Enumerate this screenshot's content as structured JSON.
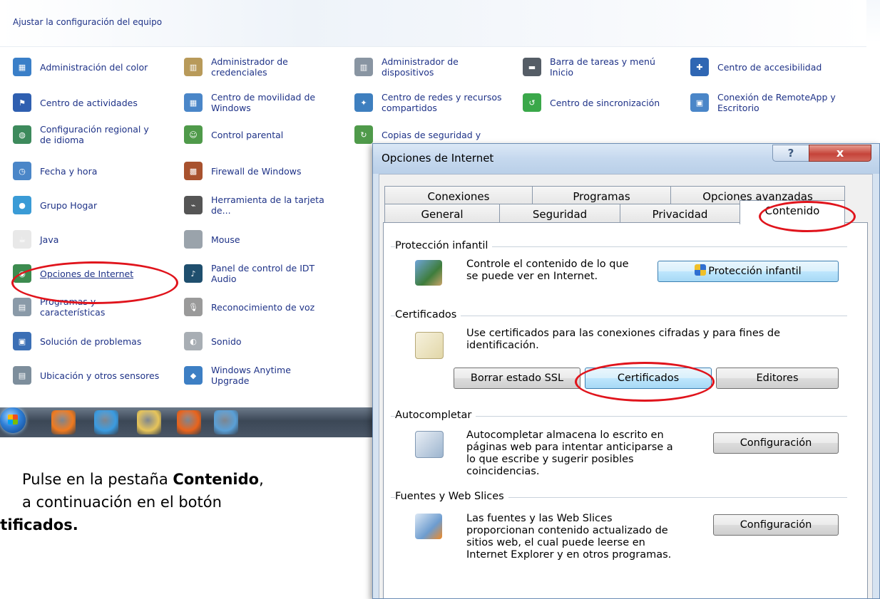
{
  "control_panel": {
    "title": "Ajustar la configuración del equipo",
    "columns": [
      [
        {
          "label": "Administración del color",
          "icon": "color-management-icon",
          "color": "#3a7fc8"
        },
        {
          "label": "Centro de actividades",
          "icon": "action-center-flag-icon",
          "color": "#2f5fb0"
        },
        {
          "label": "Configuración regional y\nde idioma",
          "icon": "region-globe-icon",
          "color": "#3d8a5c"
        },
        {
          "label": "Fecha y hora",
          "icon": "date-time-icon",
          "color": "#4a86c8"
        },
        {
          "label": "Grupo Hogar",
          "icon": "homegroup-icon",
          "color": "#3a9bd6"
        },
        {
          "label": "Java",
          "icon": "java-icon",
          "color": "#e8e8e8"
        },
        {
          "label": "Opciones de Internet",
          "icon": "internet-options-icon",
          "color": "#3c8b4f"
        },
        {
          "label": "Programas y\ncaracterísticas",
          "icon": "programs-features-icon",
          "color": "#8a9aa8"
        },
        {
          "label": "Solución de problemas",
          "icon": "troubleshooting-icon",
          "color": "#3b6fb5"
        },
        {
          "label": "Ubicación y otros sensores",
          "icon": "location-sensors-icon",
          "color": "#7d8e9c"
        }
      ],
      [
        {
          "label": "Administrador de\ncredenciales",
          "icon": "credential-manager-icon",
          "color": "#b89a5a"
        },
        {
          "label": "Centro de movilidad de\nWindows",
          "icon": "mobility-center-icon",
          "color": "#4a86c8"
        },
        {
          "label": "Control parental",
          "icon": "parental-control-icon",
          "color": "#4f9a4a"
        },
        {
          "label": "Firewall de Windows",
          "icon": "firewall-icon",
          "color": "#a8522e"
        },
        {
          "label": "Herramienta de la tarjeta\nde...",
          "icon": "card-tool-icon",
          "color": "#555555"
        },
        {
          "label": "Mouse",
          "icon": "mouse-icon",
          "color": "#9aa3ab"
        },
        {
          "label": "Panel de control de IDT\nAudio",
          "icon": "idt-audio-icon",
          "color": "#1f4f6e"
        },
        {
          "label": "Reconocimiento de voz",
          "icon": "microphone-icon",
          "color": "#9a9a9a"
        },
        {
          "label": "Sonido",
          "icon": "speaker-icon",
          "color": "#a8aeb4"
        },
        {
          "label": "Windows Anytime\nUpgrade",
          "icon": "anytime-upgrade-icon",
          "color": "#3d7fc4"
        }
      ],
      [
        {
          "label": "Administrador de\ndispositivos",
          "icon": "device-manager-icon",
          "color": "#8995a2"
        },
        {
          "label": "Centro de redes y recursos\ncompartidos",
          "icon": "network-center-icon",
          "color": "#3e7fbf"
        },
        {
          "label": "Copias de seguridad y",
          "icon": "backup-icon",
          "color": "#4f9a4a"
        }
      ],
      [
        {
          "label": "Barra de tareas y menú\nInicio",
          "icon": "taskbar-start-icon",
          "color": "#555d66"
        },
        {
          "label": "Centro de sincronización",
          "icon": "sync-center-icon",
          "color": "#3aa84a"
        }
      ],
      [
        {
          "label": "Centro de accesibilidad",
          "icon": "accessibility-icon",
          "color": "#2f66b3"
        },
        {
          "label": "Conexión de RemoteApp y\nEscritorio",
          "icon": "remoteapp-icon",
          "color": "#4a86c8"
        }
      ]
    ]
  },
  "taskbar": {
    "buttons": [
      {
        "icon": "windows-start-orb-icon"
      },
      {
        "icon": "media-player-icon",
        "color": "#f07a1f"
      },
      {
        "icon": "internet-explorer-icon",
        "color": "#3b9be0"
      },
      {
        "icon": "file-explorer-folder-icon",
        "color": "#e6c45a"
      },
      {
        "icon": "firefox-icon",
        "color": "#e8631c"
      },
      {
        "icon": "control-panel-icon",
        "color": "#5a9fd6"
      }
    ]
  },
  "instruction": {
    "line1_pre": "Pulse en la pestaña ",
    "line1_bold": "Contenido",
    "line1_post": ",",
    "line2": "a continuación en el botón",
    "line3_bold": "rtificados."
  },
  "dialog": {
    "title": "Opciones de Internet",
    "help_label": "?",
    "close_label": "x",
    "tabs_row1": [
      "Conexiones",
      "Programas",
      "Opciones avanzadas"
    ],
    "tabs_row2": [
      "General",
      "Seguridad",
      "Privacidad",
      "Contenido"
    ],
    "active_tab": "Contenido",
    "sections": {
      "family_safety": {
        "title": "Protección infantil",
        "description": "Controle el contenido de lo que\nse puede ver en Internet.",
        "button": "Protección infantil"
      },
      "certificates": {
        "title": "Certificados",
        "description": "Use certificados para las conexiones cifradas y para fines de\nidentificación.",
        "buttons": [
          "Borrar estado SSL",
          "Certificados",
          "Editores"
        ]
      },
      "autocomplete": {
        "title": "Autocompletar",
        "description": "Autocompletar almacena lo escrito en\npáginas web para intentar anticiparse a\nlo que escribe y sugerir posibles\ncoincidencias.",
        "button": "Configuración"
      },
      "feeds": {
        "title": "Fuentes y Web Slices",
        "description": "Las fuentes y las Web Slices\nproporcionan contenido actualizado de\nsitios web, el cual puede leerse en\nInternet Explorer y en otros programas.",
        "button": "Configuración"
      }
    }
  },
  "annotation_color": "#e0141c"
}
